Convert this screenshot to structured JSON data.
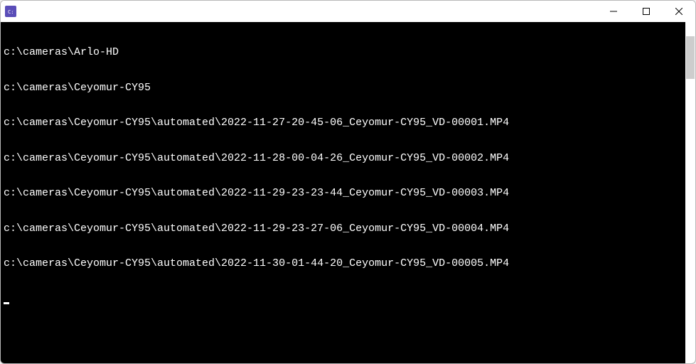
{
  "window": {
    "title": ""
  },
  "terminal": {
    "lines": [
      "c:\\cameras\\Arlo-HD",
      "c:\\cameras\\Ceyomur-CY95",
      "c:\\cameras\\Ceyomur-CY95\\automated\\2022-11-27-20-45-06_Ceyomur-CY95_VD-00001.MP4",
      "c:\\cameras\\Ceyomur-CY95\\automated\\2022-11-28-00-04-26_Ceyomur-CY95_VD-00002.MP4",
      "c:\\cameras\\Ceyomur-CY95\\automated\\2022-11-29-23-23-44_Ceyomur-CY95_VD-00003.MP4",
      "c:\\cameras\\Ceyomur-CY95\\automated\\2022-11-29-23-27-06_Ceyomur-CY95_VD-00004.MP4",
      "c:\\cameras\\Ceyomur-CY95\\automated\\2022-11-30-01-44-20_Ceyomur-CY95_VD-00005.MP4"
    ]
  }
}
